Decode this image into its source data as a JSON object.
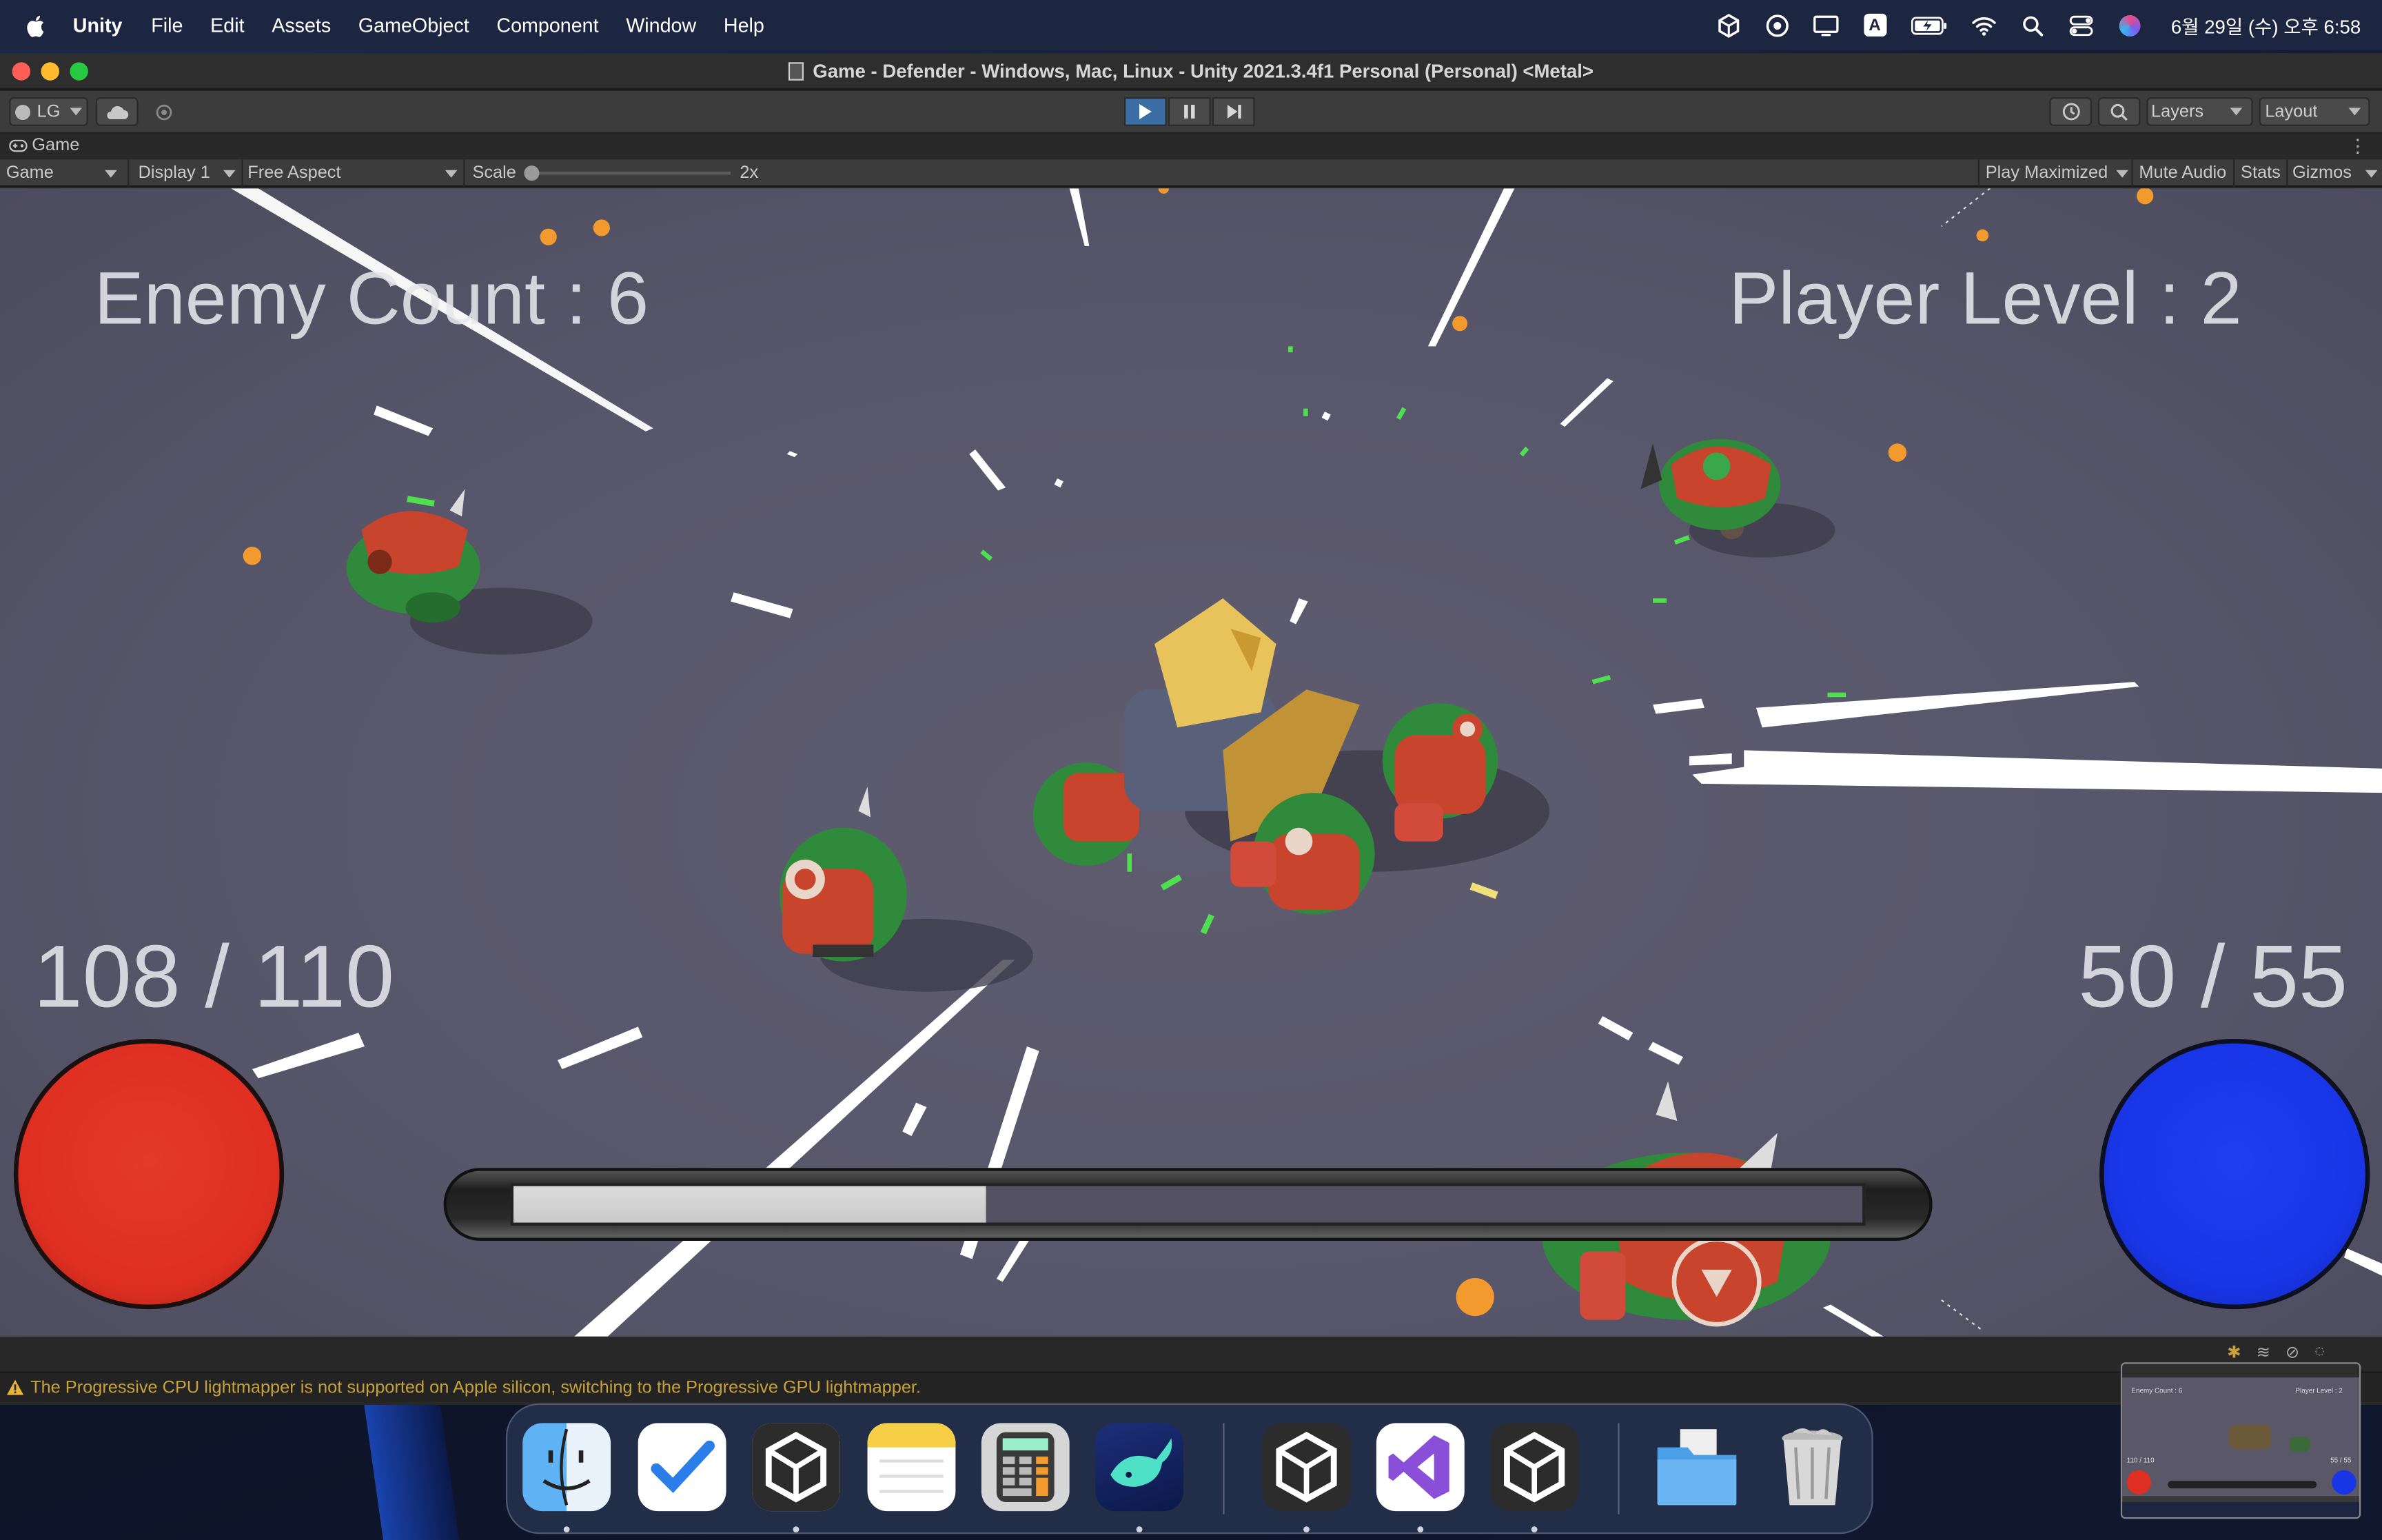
{
  "menubar": {
    "app_name": "Unity",
    "items": [
      "File",
      "Edit",
      "Assets",
      "GameObject",
      "Component",
      "Window",
      "Help"
    ],
    "status_icons": [
      "unity-hub-icon",
      "steam-icon",
      "display-icon",
      "input-source-icon",
      "battery-icon",
      "wifi-icon",
      "spotlight-search-icon",
      "control-center-icon",
      "siri-icon"
    ],
    "input_source": "A",
    "clock": "6월 29일 (수) 오후 6:58"
  },
  "window": {
    "title": "Game - Defender - Windows, Mac, Linux - Unity 2021.3.4f1 Personal (Personal) <Metal>"
  },
  "toolbar": {
    "account_label": "LG",
    "layers_label": "Layers",
    "layout_label": "Layout"
  },
  "game_tab": {
    "tab_label": "Game",
    "view_select": "Game",
    "display_select": "Display 1",
    "aspect_select": "Free Aspect",
    "scale_label": "Scale",
    "scale_value": "2x",
    "play_maximized": "Play Maximized",
    "mute_audio": "Mute Audio",
    "stats": "Stats",
    "gizmos": "Gizmos"
  },
  "hud": {
    "enemy_count": "Enemy Count : 6",
    "player_level": "Player Level : 2",
    "health": "108 / 110",
    "mana": "50 / 55",
    "experience_fraction": 0.35,
    "health_color": "#df2f22",
    "mana_color": "#1835e6"
  },
  "console": {
    "warning": "The Progressive CPU lightmapper is not supported on Apple silicon, switching to the Progressive GPU lightmapper."
  },
  "thumbnail": {
    "enemy_count": "Enemy Count : 6",
    "player_level": "Player Level : 2",
    "health": "110 / 110",
    "mana": "55 / 55"
  },
  "dock": {
    "apps": [
      "finder-icon",
      "todo-icon",
      "unity-icon",
      "notes-icon",
      "calculator-icon",
      "whale-browser-icon",
      "unity-icon",
      "visual-studio-icon",
      "unity-icon",
      "downloads-folder-icon",
      "trash-icon"
    ]
  }
}
